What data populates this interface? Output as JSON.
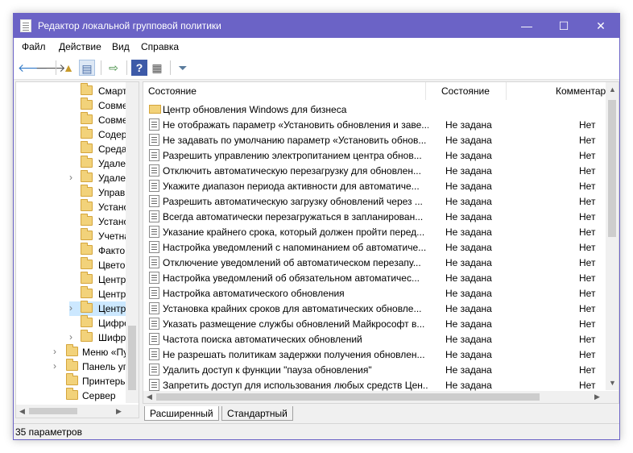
{
  "window": {
    "title": "Редактор локальной групповой политики",
    "minimize": "—",
    "maximize": "☐",
    "close": "✕"
  },
  "menu": [
    "Файл",
    "Действие",
    "Вид",
    "Справка"
  ],
  "toolbar": [
    "back-icon",
    "forward-icon",
    "up-folder-icon",
    "show-hide-tree-icon",
    "export-list-icon",
    "help-icon",
    "properties-icon",
    "filter-icon"
  ],
  "tree": [
    {
      "label": "Смарт",
      "expandable": false
    },
    {
      "label": "Совме",
      "expandable": false
    },
    {
      "label": "Совме",
      "expandable": false
    },
    {
      "label": "Содер",
      "expandable": false
    },
    {
      "label": "Среда",
      "expandable": false
    },
    {
      "label": "Удален",
      "expandable": false
    },
    {
      "label": "Удален",
      "expandable": true
    },
    {
      "label": "Управ.",
      "expandable": false
    },
    {
      "label": "Устано",
      "expandable": false
    },
    {
      "label": "Устано",
      "expandable": false
    },
    {
      "label": "Учетна",
      "expandable": false
    },
    {
      "label": "Фактор",
      "expandable": false
    },
    {
      "label": "Цветов",
      "expandable": false
    },
    {
      "label": "Центр",
      "expandable": false
    },
    {
      "label": "Центр",
      "expandable": false
    },
    {
      "label": "Центр",
      "expandable": true,
      "selected": true
    },
    {
      "label": "Цифро",
      "expandable": false
    },
    {
      "label": "Шифр",
      "expandable": true
    },
    {
      "label": "Меню «Пу",
      "expandable": true,
      "level": 0
    },
    {
      "label": "Панель упр",
      "expandable": true,
      "level": 0
    },
    {
      "label": "Принтеры",
      "expandable": false,
      "level": 0
    },
    {
      "label": "Сервер",
      "expandable": false,
      "level": 0
    }
  ],
  "list": {
    "headers": {
      "name": "Состояние",
      "state": "Состояние",
      "comment": "Комментар"
    },
    "folder_row": "Центр обновления Windows для бизнеса",
    "rows": [
      {
        "name": "Не отображать параметр «Установить обновления и заве...",
        "state": "Не задана",
        "comment": "Нет"
      },
      {
        "name": "Не задавать по умолчанию параметр «Установить обнов...",
        "state": "Не задана",
        "comment": "Нет"
      },
      {
        "name": "Разрешить управлению электропитанием центра обнов...",
        "state": "Не задана",
        "comment": "Нет"
      },
      {
        "name": "Отключить автоматическую перезагрузку для обновлен...",
        "state": "Не задана",
        "comment": "Нет"
      },
      {
        "name": "Укажите диапазон периода активности для автоматиче...",
        "state": "Не задана",
        "comment": "Нет"
      },
      {
        "name": "Разрешить автоматическую загрузку обновлений через ...",
        "state": "Не задана",
        "comment": "Нет"
      },
      {
        "name": "Всегда автоматически перезагружаться в запланирован...",
        "state": "Не задана",
        "comment": "Нет"
      },
      {
        "name": "Указание крайнего срока, который должен пройти перед...",
        "state": "Не задана",
        "comment": "Нет"
      },
      {
        "name": "Настройка уведомлений с напоминанием об автоматиче...",
        "state": "Не задана",
        "comment": "Нет"
      },
      {
        "name": "Отключение уведомлений об автоматическом перезапу...",
        "state": "Не задана",
        "comment": "Нет"
      },
      {
        "name": "Настройка уведомлений об обязательном автоматичес...",
        "state": "Не задана",
        "comment": "Нет"
      },
      {
        "name": "Настройка автоматического обновления",
        "state": "Не задана",
        "comment": "Нет"
      },
      {
        "name": "Установка крайних сроков для автоматических обновле...",
        "state": "Не задана",
        "comment": "Нет"
      },
      {
        "name": "Указать размещение службы обновлений Майкрософт в...",
        "state": "Не задана",
        "comment": "Нет"
      },
      {
        "name": "Частота поиска автоматических обновлений",
        "state": "Не задана",
        "comment": "Нет"
      },
      {
        "name": "Не разрешать политикам задержки получения обновлен...",
        "state": "Не задана",
        "comment": "Нет"
      },
      {
        "name": "Удалить доступ к функции \"пауза обновления\"",
        "state": "Не задана",
        "comment": "Нет"
      },
      {
        "name": "Запретить доступ для использования любых средств Цен...",
        "state": "Не задана",
        "comment": "Нет"
      }
    ]
  },
  "tabs": [
    "Расширенный",
    "Стандартный"
  ],
  "status": "35 параметров"
}
